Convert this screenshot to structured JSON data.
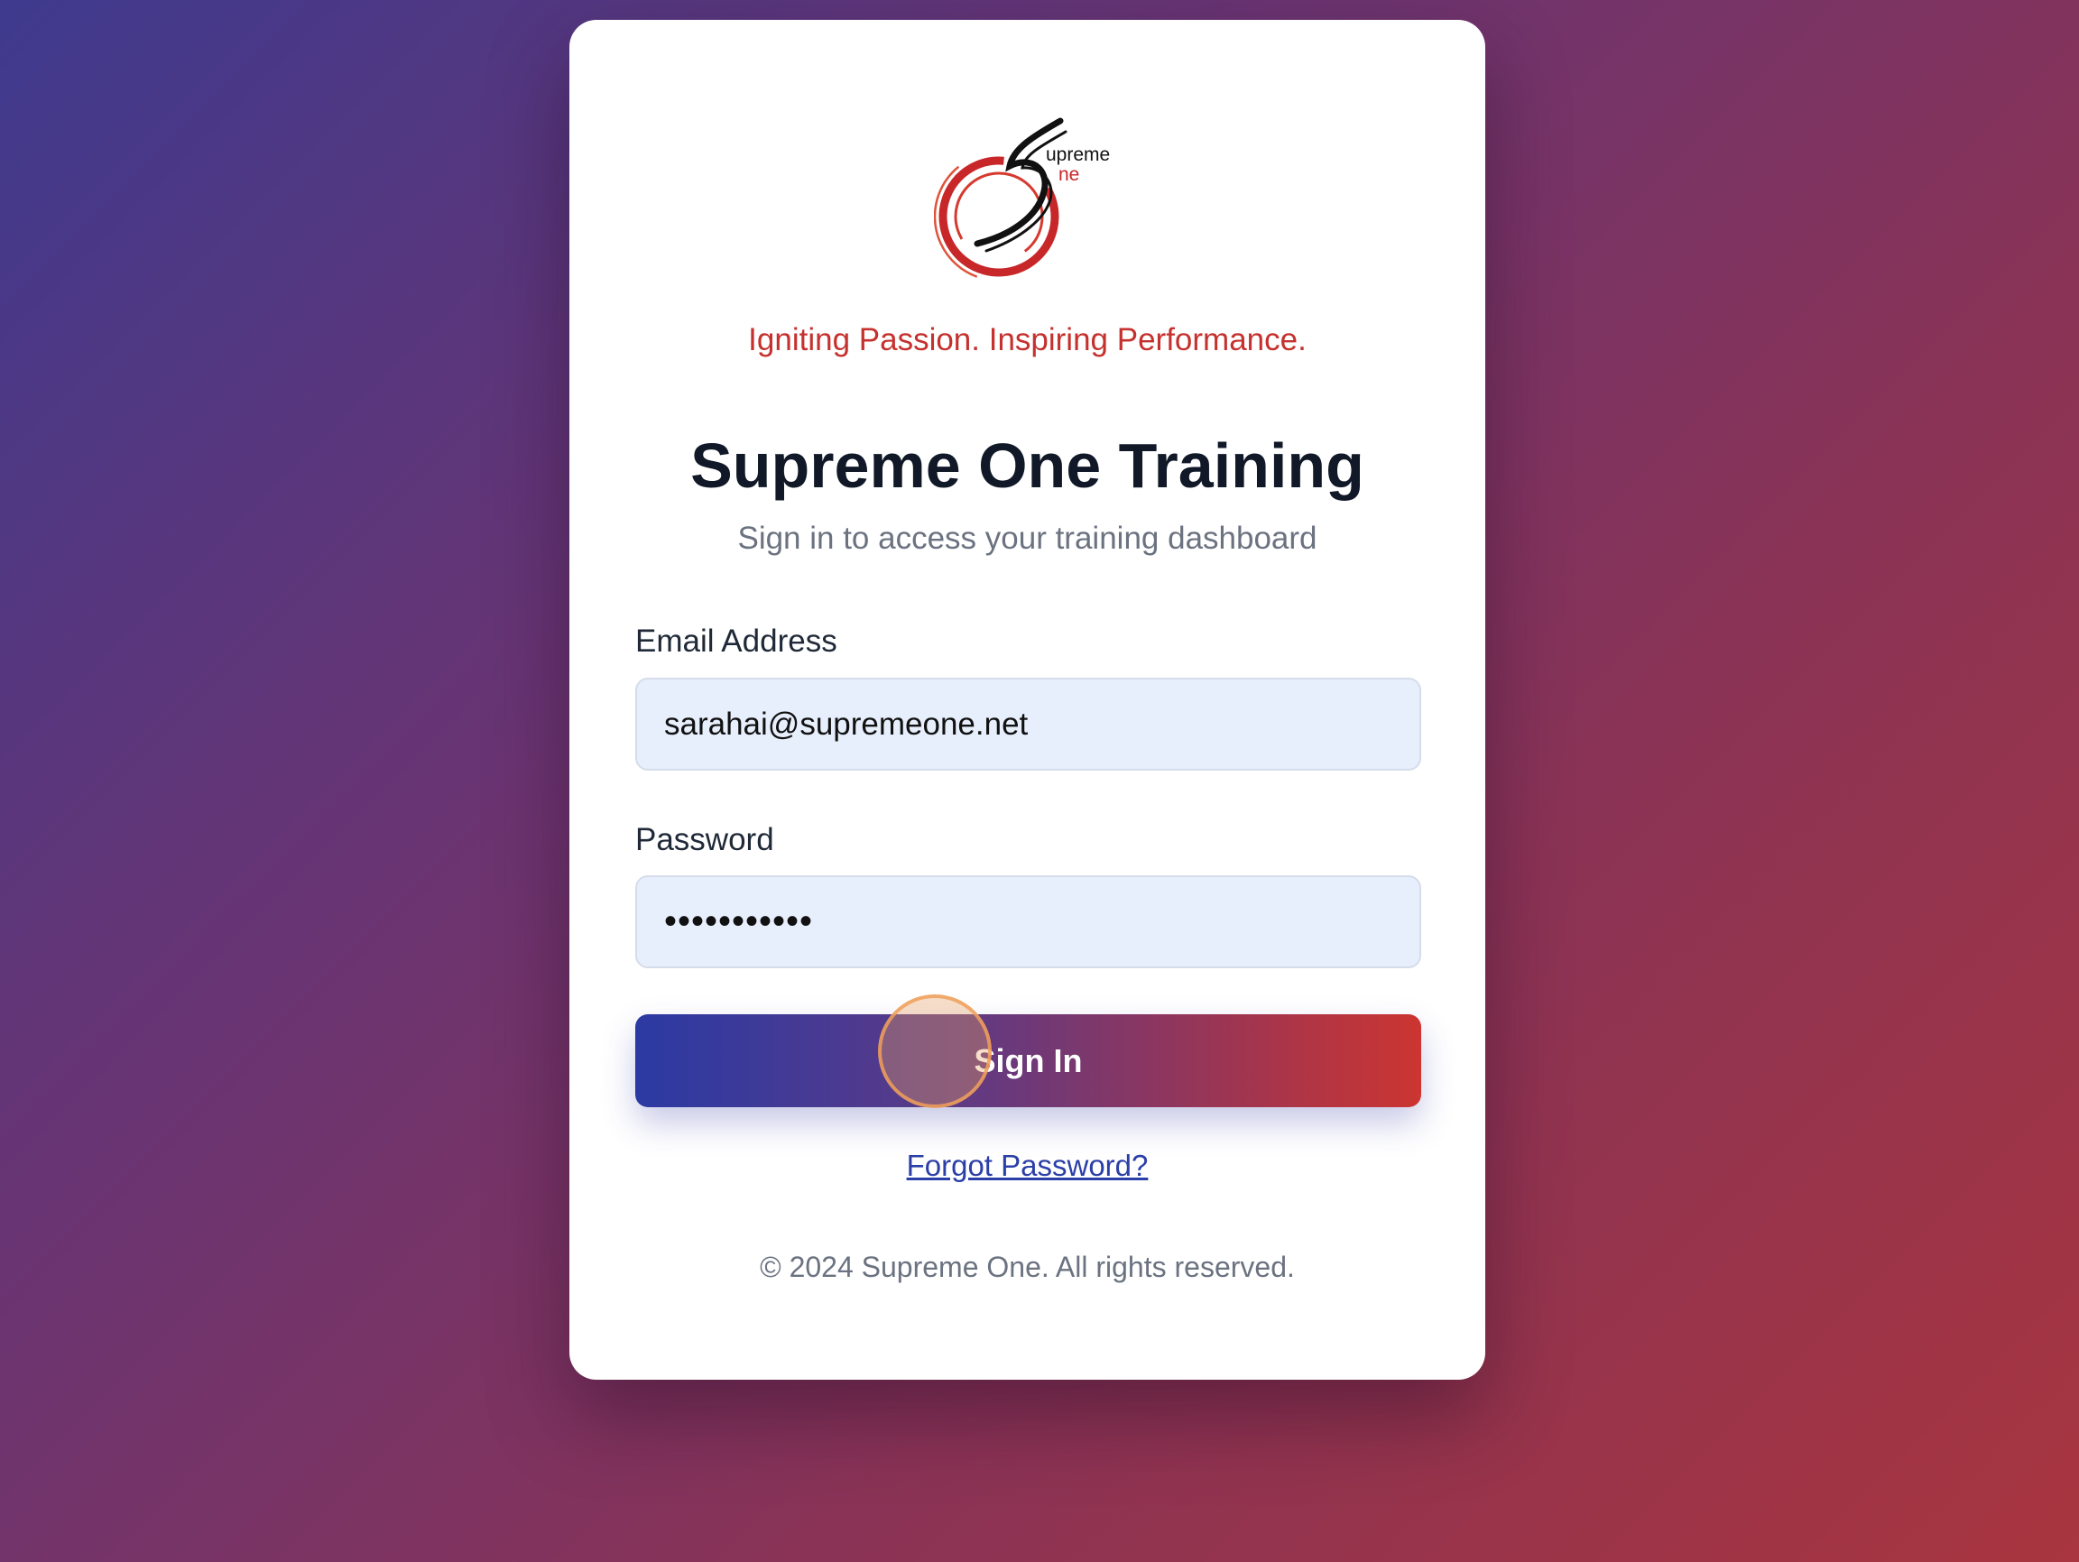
{
  "brand": {
    "logo_text_top": "upreme",
    "logo_text_bottom": "ne",
    "tagline": "Igniting Passion. Inspiring Performance.",
    "accent_color": "#c5312e"
  },
  "login": {
    "title": "Supreme One Training",
    "subtitle": "Sign in to access your training dashboard",
    "email_label": "Email Address",
    "email_value": "sarahai@supremeone.net",
    "password_label": "Password",
    "password_value": "•••••••••••",
    "sign_in_label": "Sign In",
    "forgot_password_label": "Forgot Password?"
  },
  "footer": {
    "copyright": "© 2024 Supreme One. All rights reserved."
  }
}
